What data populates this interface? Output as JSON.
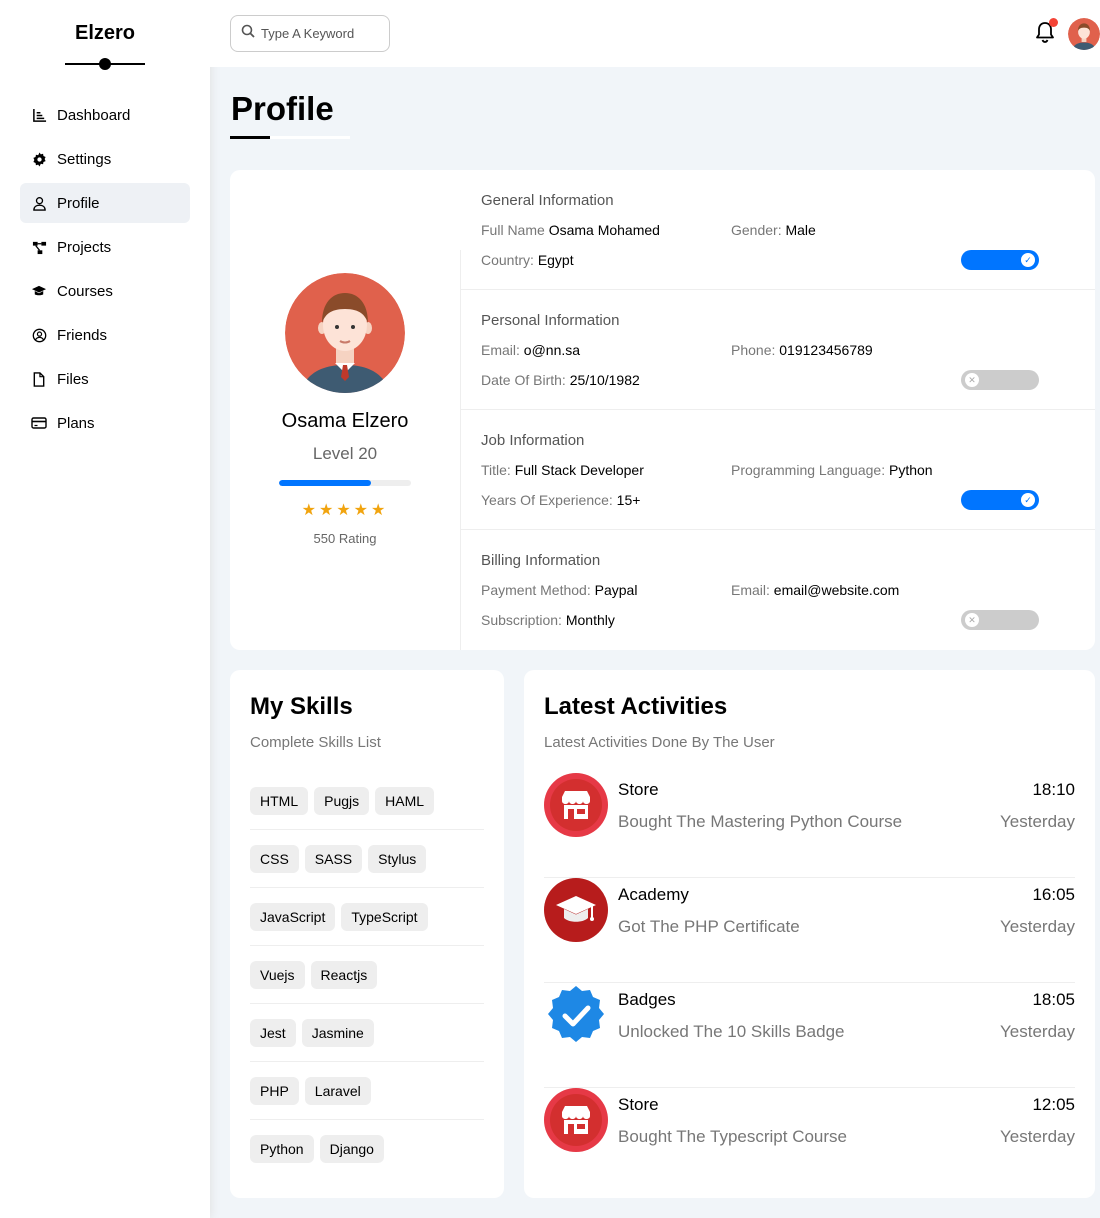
{
  "brand": {
    "name": "Elzero"
  },
  "nav": {
    "items": [
      {
        "label": "Dashboard",
        "icon": "chart-icon"
      },
      {
        "label": "Settings",
        "icon": "gear-icon"
      },
      {
        "label": "Profile",
        "icon": "user-icon",
        "active": true
      },
      {
        "label": "Projects",
        "icon": "diagram-icon"
      },
      {
        "label": "Courses",
        "icon": "graduation-cap-icon"
      },
      {
        "label": "Friends",
        "icon": "user-circle-icon"
      },
      {
        "label": "Files",
        "icon": "file-icon"
      },
      {
        "label": "Plans",
        "icon": "credit-card-icon"
      }
    ]
  },
  "header": {
    "search_placeholder": "Type A Keyword",
    "has_notification": true
  },
  "page": {
    "title": "Profile"
  },
  "profile": {
    "name": "Osama Elzero",
    "level": "Level 20",
    "progress_fraction": 0.7,
    "stars": 5,
    "rating": "550 Rating"
  },
  "info": {
    "general": {
      "title": "General Information",
      "full_name_label": "Full Name",
      "full_name": "Osama Mohamed",
      "gender_label": "Gender:",
      "gender": "Male",
      "country_label": "Country:",
      "country": "Egypt",
      "toggle_on": true
    },
    "personal": {
      "title": "Personal Information",
      "email_label": "Email:",
      "email": "o@nn.sa",
      "phone_label": "Phone:",
      "phone": "019123456789",
      "dob_label": "Date Of Birth:",
      "dob": "25/10/1982",
      "toggle_on": false
    },
    "job": {
      "title": "Job Information",
      "title_label": "Title:",
      "job_title": "Full Stack Developer",
      "lang_label": "Programming Language:",
      "lang": "Python",
      "years_label": "Years Of Experience:",
      "years": "15+",
      "toggle_on": true
    },
    "billing": {
      "title": "Billing Information",
      "method_label": "Payment Method:",
      "method": "Paypal",
      "email_label": "Email:",
      "email": "email@website.com",
      "sub_label": "Subscription:",
      "sub": "Monthly",
      "toggle_on": false
    }
  },
  "skills": {
    "title": "My Skills",
    "subtitle": "Complete Skills List",
    "rows": [
      [
        "HTML",
        "Pugjs",
        "HAML"
      ],
      [
        "CSS",
        "SASS",
        "Stylus"
      ],
      [
        "JavaScript",
        "TypeScript"
      ],
      [
        "Vuejs",
        "Reactjs"
      ],
      [
        "Jest",
        "Jasmine"
      ],
      [
        "PHP",
        "Laravel"
      ],
      [
        "Python",
        "Django"
      ]
    ]
  },
  "activities": {
    "title": "Latest Activities",
    "subtitle": "Latest Activities Done By The User",
    "items": [
      {
        "icon": "store-icon",
        "title": "Store",
        "desc": "Bought The Mastering Python Course",
        "time": "18:10",
        "day": "Yesterday"
      },
      {
        "icon": "academy-icon",
        "title": "Academy",
        "desc": "Got The PHP Certificate",
        "time": "16:05",
        "day": "Yesterday"
      },
      {
        "icon": "badge-icon",
        "title": "Badges",
        "desc": "Unlocked The 10 Skills Badge",
        "time": "18:05",
        "day": "Yesterday"
      },
      {
        "icon": "store-icon",
        "title": "Store",
        "desc": "Bought The Typescript Course",
        "time": "12:05",
        "day": "Yesterday"
      }
    ]
  },
  "colors": {
    "accent": "#0075ff",
    "star": "#f1a40f",
    "notification": "#f44336",
    "store": "#e63946",
    "academy": "#c0392b",
    "badge": "#1e88e5"
  }
}
